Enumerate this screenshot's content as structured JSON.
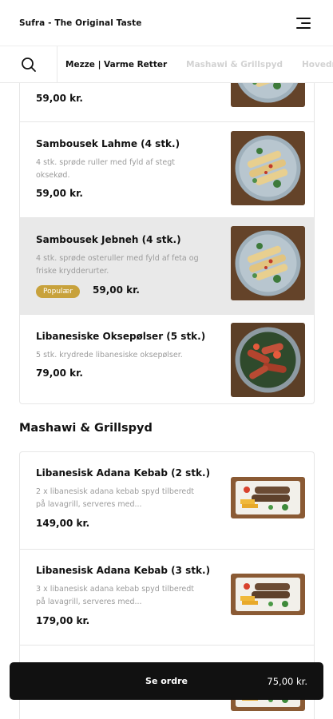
{
  "header": {
    "title": "Sufra - The Original Taste",
    "menu_icon": "hamburger-icon"
  },
  "category_tabs": {
    "search_icon": "search-icon",
    "tabs": [
      {
        "label": "Mezze | Varme Retter",
        "active": true
      },
      {
        "label": "Mashawi & Grillspyd",
        "active": false
      },
      {
        "label": "Hovedr",
        "active": false
      }
    ]
  },
  "mezze_items": [
    {
      "name": "",
      "description": "",
      "price": "59,00 kr."
    },
    {
      "name": "Sambousek Lahme (4 stk.)",
      "description": "4 stk. sprøde ruller med fyld af stegt oksekød.",
      "price": "59,00 kr."
    },
    {
      "name": "Sambousek Jebneh (4 stk.)",
      "description": "4 stk. sprøde osteruller med fyld af feta og friske krydderurter.",
      "badge": "Populær",
      "price": "59,00 kr."
    },
    {
      "name": "Libanesiske Oksepølser (5 stk.)",
      "description": "5 stk. krydrede libanesiske oksepølser.",
      "price": "79,00 kr."
    }
  ],
  "grill_section": {
    "title": "Mashawi & Grillspyd"
  },
  "grill_items": [
    {
      "name": "Libanesisk Adana Kebab (2 stk.)",
      "description": "2 x libanesisk adana kebab spyd tilberedt på lavagrill, serveres med...",
      "price": "149,00 kr."
    },
    {
      "name": "Libanesisk Adana Kebab (3 stk.)",
      "description": "3 x libanesisk adana kebab spyd tilberedt på lavagrill, serveres med...",
      "price": "179,00 kr."
    },
    {
      "name": "",
      "description": "",
      "price": ""
    }
  ],
  "order_bar": {
    "label": "Se ordre",
    "total": "75,00 kr."
  },
  "colors": {
    "badge": "#c8a23c",
    "highlight": "#e9e9e9",
    "order_bar": "#111111"
  }
}
